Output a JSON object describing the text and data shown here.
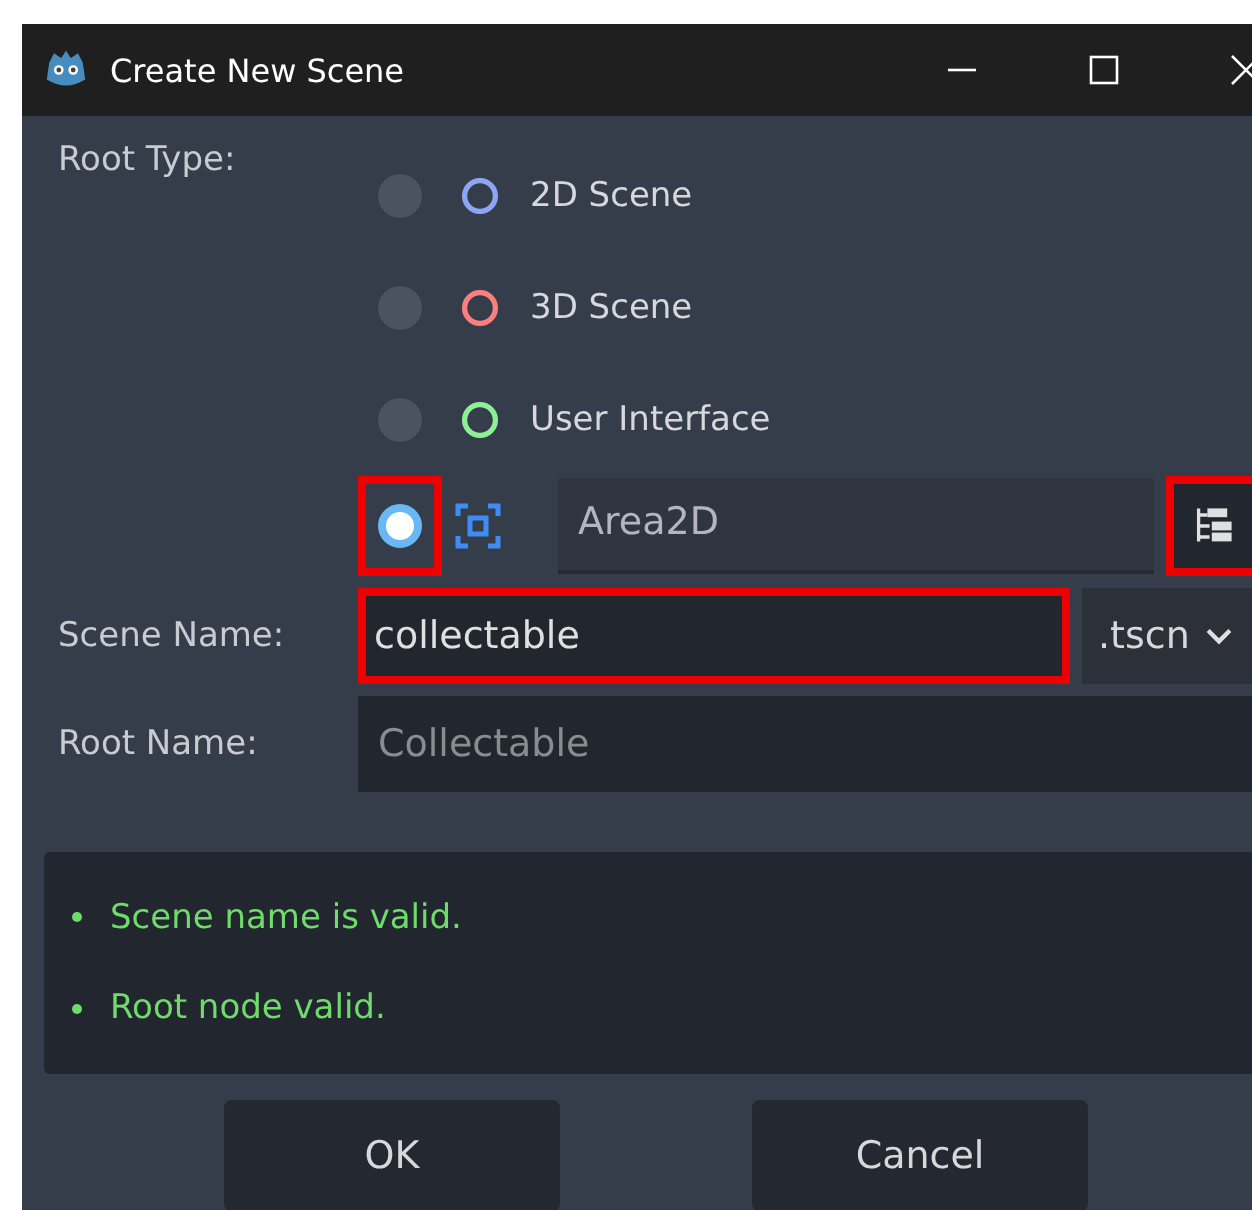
{
  "window": {
    "title": "Create New Scene"
  },
  "root_type": {
    "label": "Root Type:",
    "options": [
      {
        "kind": "preset",
        "label": "2D Scene",
        "color": "#8da5f3",
        "selected": false,
        "highlighted": false
      },
      {
        "kind": "preset",
        "label": "3D Scene",
        "color": "#fc7f7f",
        "selected": false,
        "highlighted": false
      },
      {
        "kind": "preset",
        "label": "User Interface",
        "color": "#8eef97",
        "selected": false,
        "highlighted": false
      },
      {
        "kind": "custom",
        "value": "Area2D",
        "selected": true,
        "highlighted": true
      }
    ],
    "pick_button": {
      "highlighted": true
    }
  },
  "scene_name": {
    "label": "Scene Name:",
    "value": "collectable",
    "highlighted": true,
    "extension": ".tscn"
  },
  "root_name": {
    "label": "Root Name:",
    "placeholder": "Collectable"
  },
  "messages": [
    "Scene name is valid.",
    "Root node valid."
  ],
  "buttons": [
    "OK",
    "Cancel"
  ]
}
